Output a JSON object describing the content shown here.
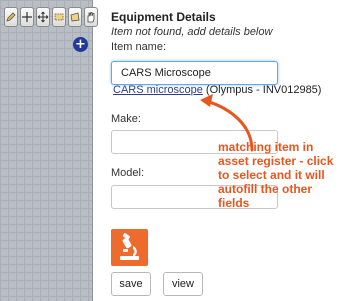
{
  "toolbar": {
    "tools": [
      {
        "icon": "pencil-icon"
      },
      {
        "icon": "crosshair-icon"
      },
      {
        "icon": "move-icon"
      },
      {
        "icon": "rectangle-select-icon"
      },
      {
        "icon": "polygon-select-icon"
      },
      {
        "icon": "hand-icon"
      }
    ],
    "add_label": "+"
  },
  "panel": {
    "title": "Equipment Details",
    "subtitle": "Item not found, add details below",
    "item_name_label": "Item name:",
    "item_name_value": "CARS Microscope",
    "match_link": "CARS microscope",
    "match_detail": "(Olympus - INV012985)",
    "make_label": "Make:",
    "make_value": "",
    "model_label": "Model:",
    "model_value": "",
    "save_label": "save",
    "view_label": "view"
  },
  "annotation": {
    "text": "matching item in asset register - click to select and it will autofill the other fields",
    "color": "#e8561e"
  },
  "colors": {
    "accent_orange": "#ec6b2d",
    "link": "#2b3f8c",
    "add_button": "#1f3a9a"
  }
}
